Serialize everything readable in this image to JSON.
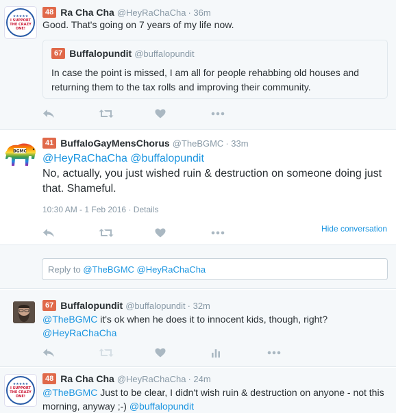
{
  "tweets": [
    {
      "score": "48",
      "fullname": "Ra Cha Cha",
      "handle": "@HeyRaChaCha",
      "time": "· 36m",
      "text": "Good. That's going on 7 years of my life now.",
      "avatar_text": "I SUPPORT THE CRAZY ONE!",
      "avatar_stars": "★★★★★",
      "quote": {
        "score": "67",
        "fullname": "Buffalopundit",
        "handle": "@buffalopundit",
        "text": "In case the point is missed, I am all for people rehabbing old houses and returning them to the tax rolls and improving their community."
      }
    },
    {
      "score": "41",
      "fullname": "BuffaloGayMensChorus",
      "handle": "@TheBGMC",
      "time": "· 33m",
      "avatar_text": "BGMC",
      "mention_line": "@HeyRaChaCha @buffalopundit",
      "text": "No, actually, you just wished ruin & destruction on someone doing just that. Shameful.",
      "timestamp": "10:30 AM - 1 Feb 2016",
      "details": "Details",
      "hide_conversation": "Hide conversation"
    },
    {
      "score": "67",
      "fullname": "Buffalopundit",
      "handle": "@buffalopundit",
      "time": "· 32m",
      "mention_start": "@TheBGMC",
      "text": " it's ok when he does it to innocent kids, though, right?",
      "mention_end": "@HeyRaChaCha"
    },
    {
      "score": "48",
      "fullname": "Ra Cha Cha",
      "handle": "@HeyRaChaCha",
      "time": "· 24m",
      "avatar_text": "I SUPPORT THE CRAZY ONE!",
      "avatar_stars": "★★★★★",
      "mention_start": "@TheBGMC",
      "text": " Just to be clear, I didn't wish ruin & destruction on anyone - not this morning, anyway ;-) ",
      "mention_end": "@buffalopundit"
    }
  ],
  "reply": {
    "prefix": "Reply to ",
    "mentions": "@TheBGMC @HeyRaChaCha"
  },
  "colors": {
    "score_badge": "#e0694a",
    "link": "#1b95e0",
    "muted": "#8899a6",
    "icon": "#aab8c2"
  }
}
